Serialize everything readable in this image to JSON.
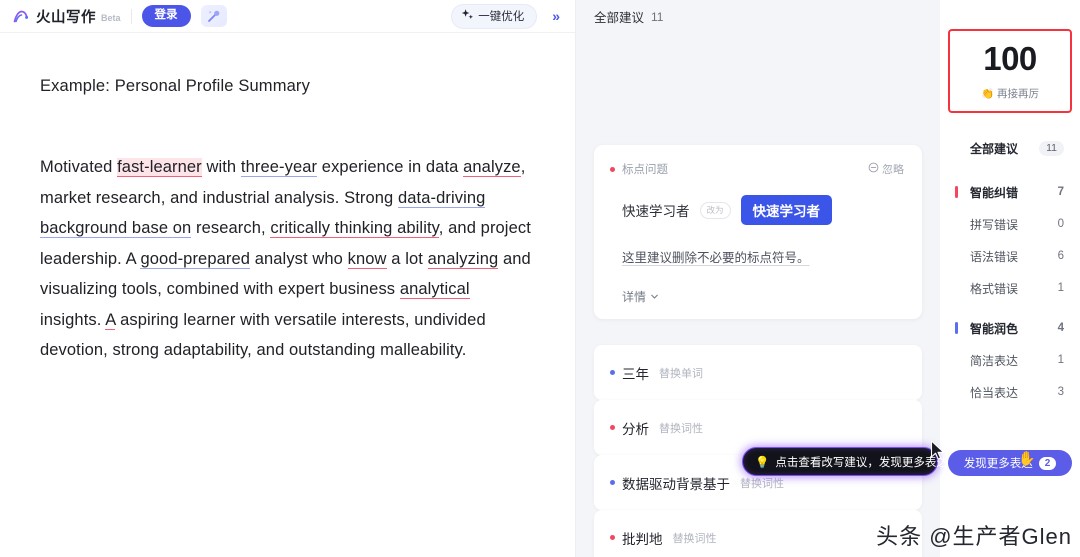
{
  "editor": {
    "brand_name": "火山写作",
    "beta_label": "Beta",
    "login_label": "登录",
    "magic_icon": "magic-wand-icon",
    "optimize_label": "一键优化",
    "optimize_icon": "sparkle-icon",
    "expand_icon": "double-chevron-right-icon",
    "doc_title": "Example: Personal Profile Summary",
    "paragraph": {
      "segments": [
        {
          "text": "Motivated ",
          "mark": "none"
        },
        {
          "text": "fast-learner",
          "mark": "redfill"
        },
        {
          "text": " with ",
          "mark": "none"
        },
        {
          "text": "three-year",
          "mark": "blue"
        },
        {
          "text": " experience in data ",
          "mark": "none"
        },
        {
          "text": "analyze",
          "mark": "red"
        },
        {
          "text": ", market research, and industrial analysis. Strong ",
          "mark": "none"
        },
        {
          "text": "data-driving background base on",
          "mark": "blue"
        },
        {
          "text": " research, ",
          "mark": "none"
        },
        {
          "text": "critically thinking ability",
          "mark": "red"
        },
        {
          "text": ", and project leadership. A ",
          "mark": "none"
        },
        {
          "text": "good-prepared",
          "mark": "blue"
        },
        {
          "text": " analyst who ",
          "mark": "none"
        },
        {
          "text": "know",
          "mark": "red"
        },
        {
          "text": " a lot ",
          "mark": "none"
        },
        {
          "text": "analyzing",
          "mark": "red"
        },
        {
          "text": " and visualizing tools, combined with expert business ",
          "mark": "none"
        },
        {
          "text": "analytical",
          "mark": "red"
        },
        {
          "text": " insights. ",
          "mark": "none"
        },
        {
          "text": "A",
          "mark": "red"
        },
        {
          "text": " aspiring learner with versatile interests, undivided devotion, strong adaptability, and outstanding malleability.",
          "mark": "none"
        }
      ]
    }
  },
  "suggestions": {
    "header_label": "全部建议",
    "header_count": "11",
    "card": {
      "category": "标点问题",
      "category_dot": "red",
      "ignore_label": "忽略",
      "ignore_icon": "circle-minus-icon",
      "original_word": "快速学习者",
      "arrow_label": "改为",
      "replacement_word": "快速学习者",
      "description": "这里建议删除不必要的标点符号。",
      "more_label": "详情",
      "more_icon": "chevron-down-icon"
    },
    "rows": [
      {
        "word": "三年",
        "tag": "替换单词",
        "dot": "blue"
      },
      {
        "word": "分析",
        "tag": "替换词性",
        "dot": "red"
      },
      {
        "word": "数据驱动背景基于",
        "tag": "替换词性",
        "dot": "blue"
      },
      {
        "word": "批判地",
        "tag": "替换词性",
        "dot": "red"
      }
    ],
    "tooltip": {
      "icon": "lightbulb-icon",
      "text": "点击查看改写建议，发现更多表达"
    }
  },
  "sidebar": {
    "score": {
      "value": "100",
      "caption": "再接再厉",
      "caption_icon": "clap-emoji"
    },
    "items": [
      {
        "label": "全部建议",
        "count": "11",
        "kind": "all",
        "bar": "none"
      },
      {
        "label": "智能纠错",
        "count": "7",
        "kind": "grp",
        "bar": "red"
      },
      {
        "label": "拼写错误",
        "count": "0",
        "kind": "sub",
        "bar": "none"
      },
      {
        "label": "语法错误",
        "count": "6",
        "kind": "sub",
        "bar": "none"
      },
      {
        "label": "格式错误",
        "count": "1",
        "kind": "sub",
        "bar": "none"
      },
      {
        "label": "智能润色",
        "count": "4",
        "kind": "grp",
        "bar": "blue"
      },
      {
        "label": "简洁表达",
        "count": "1",
        "kind": "sub",
        "bar": "none"
      },
      {
        "label": "恰当表达",
        "count": "3",
        "kind": "sub",
        "bar": "none"
      }
    ],
    "discover": {
      "label": "发现更多表达",
      "badge": "2"
    }
  },
  "watermark": "头条 @生产者Glen",
  "colors": {
    "brand_purple": "#4b56e8",
    "chip_blue": "#3b55e8",
    "error_red": "#f2485f",
    "polish_blue": "#5b6ef0",
    "score_border": "#f5333f",
    "tooltip_glow": "#7b4ff0"
  }
}
